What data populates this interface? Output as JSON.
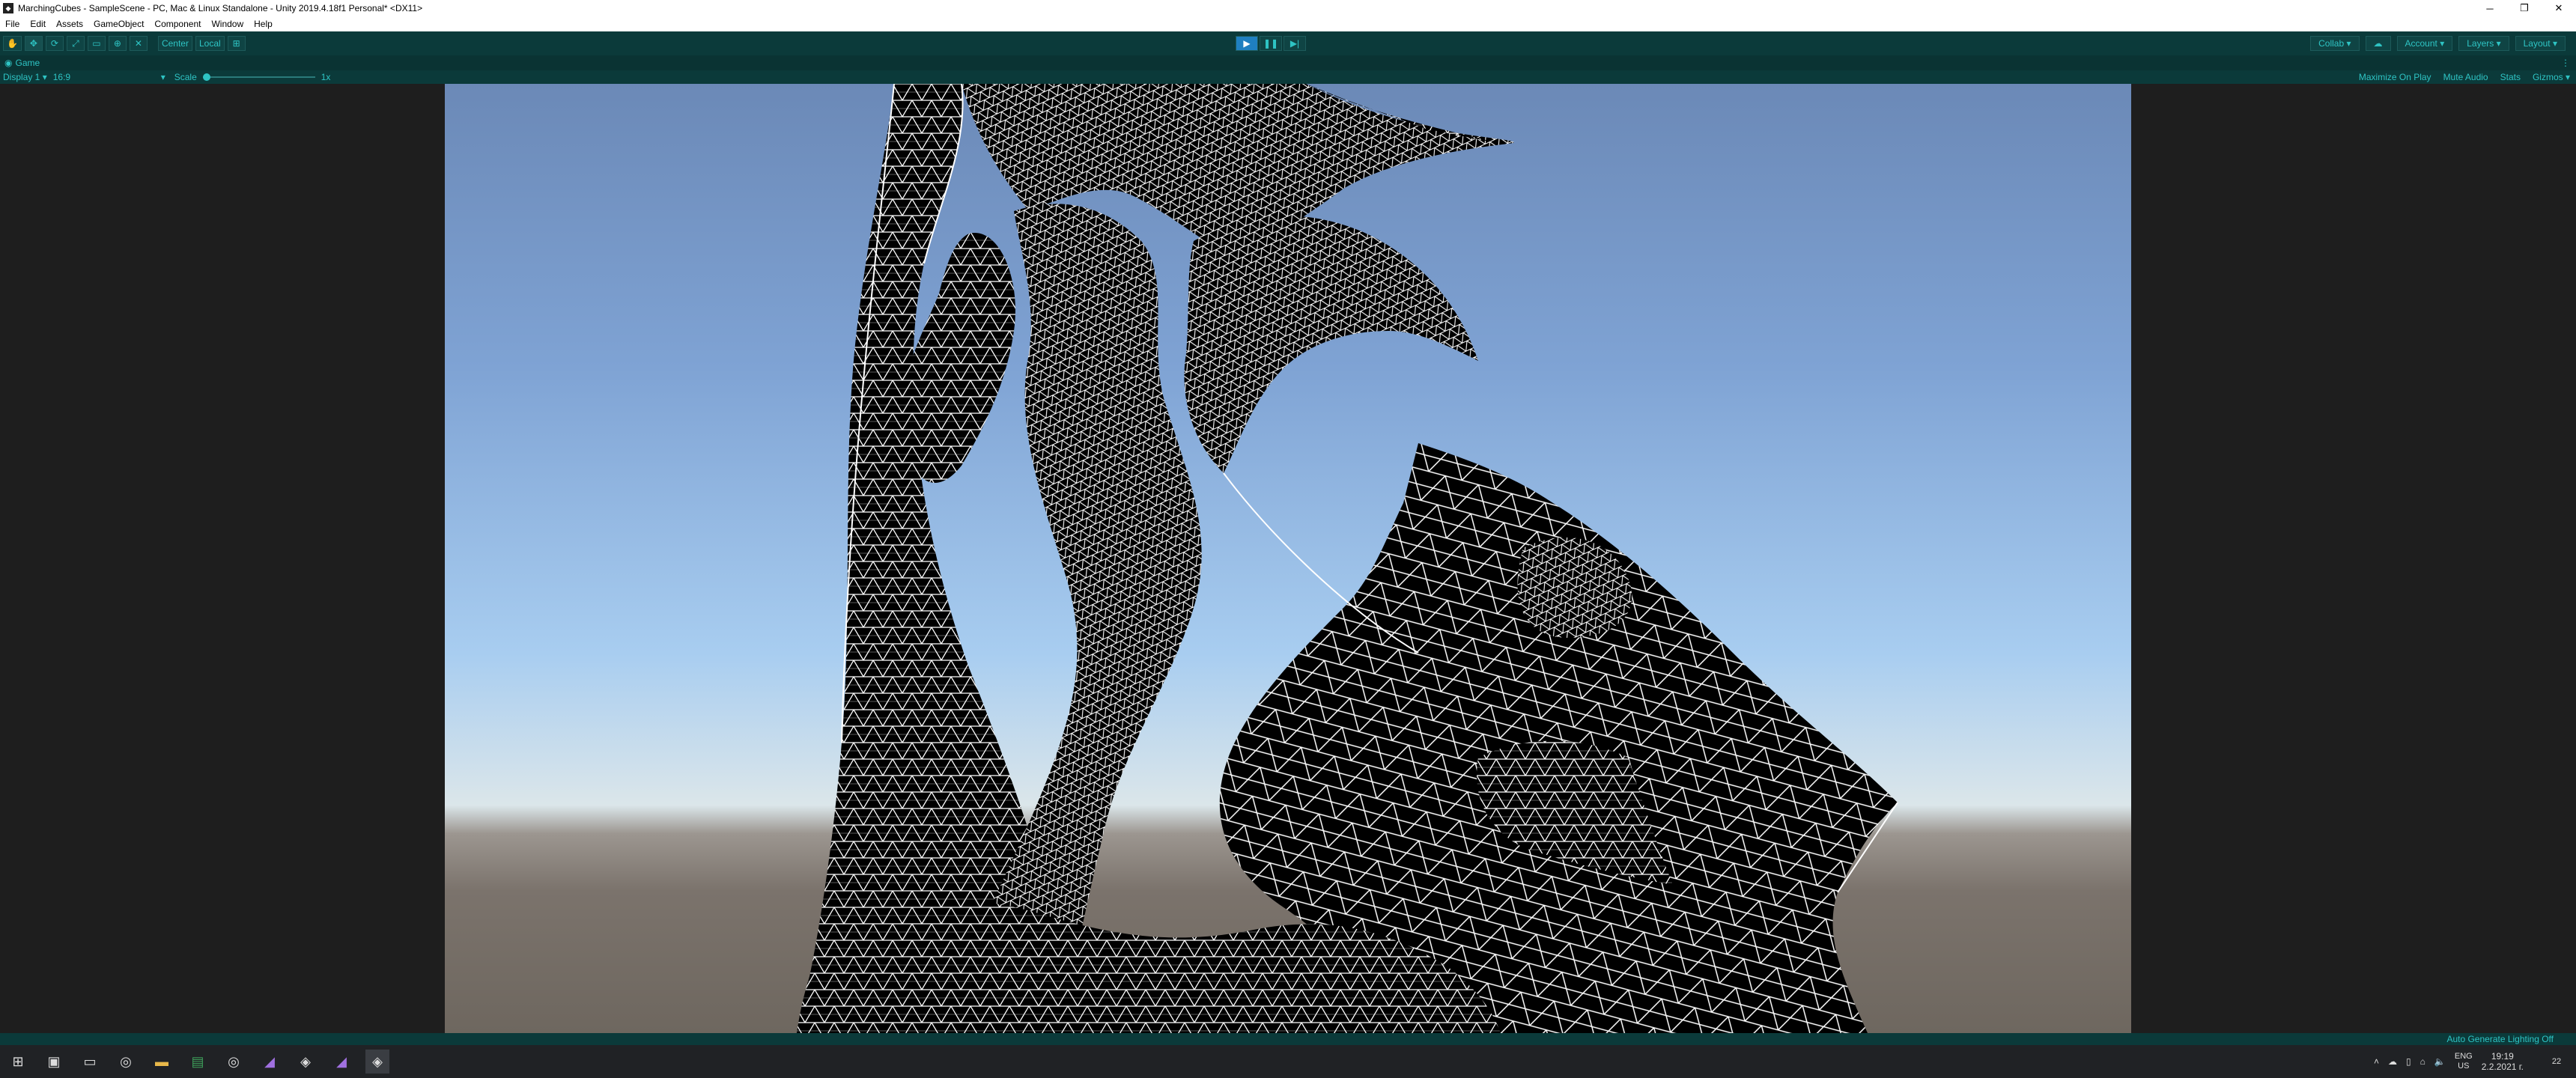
{
  "window": {
    "title": "MarchingCubes - SampleScene - PC, Mac & Linux Standalone - Unity 2019.4.18f1 Personal* <DX11>",
    "app_icon": "unity-icon",
    "minimize": "─",
    "restore": "❐",
    "close": "✕"
  },
  "menu": [
    "File",
    "Edit",
    "Assets",
    "GameObject",
    "Component",
    "Window",
    "Help"
  ],
  "toolbar": {
    "tools": [
      "hand-tool-icon",
      "move-tool-icon",
      "rotate-tool-icon",
      "scale-tool-icon",
      "rect-tool-icon",
      "transform-tool-icon",
      "custom-tool-icon"
    ],
    "pivot": "Center",
    "space": "Local",
    "play": "▶",
    "pause": "❚❚",
    "step": "▶|",
    "collab": "Collab",
    "account": "Account",
    "layers": "Layers",
    "layout": "Layout"
  },
  "game_tab": {
    "label": "Game",
    "menu": "⋮"
  },
  "game_bar": {
    "display": "Display 1",
    "aspect": "16:9",
    "scale_label": "Scale",
    "scale_value": "1x",
    "maximize_on_play": "Maximize On Play",
    "mute_audio": "Mute Audio",
    "stats": "Stats",
    "gizmos": "Gizmos"
  },
  "status": {
    "lighting": "Auto Generate Lighting Off"
  },
  "taskbar": {
    "items": [
      "windows-start-icon",
      "task-view-icon",
      "file-explorer-icon",
      "chrome-icon",
      "folder-icon",
      "excel-icon",
      "chrome-icon",
      "visual-studio-icon",
      "unity-icon",
      "visual-studio-icon",
      "unity-icon"
    ],
    "lang_top": "ENG",
    "lang_bottom": "US",
    "time": "19:19",
    "date": "2.2.2021 г.",
    "notifications": "22"
  },
  "colors": {
    "accent": "#2ec4c4",
    "toolbar_bg": "#0b3a3a",
    "wireframe": "#ffffff",
    "mesh_fill": "#000000"
  }
}
